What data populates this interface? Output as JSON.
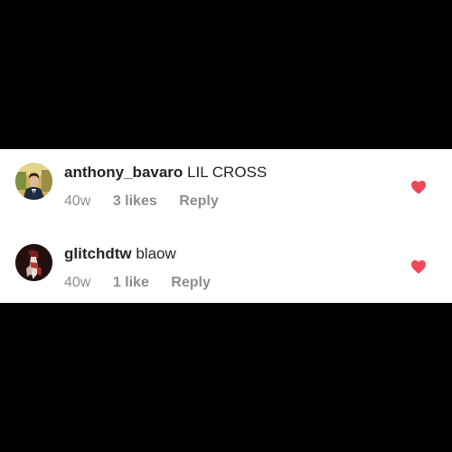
{
  "colors": {
    "background": "#000000",
    "panel": "#ffffff",
    "username": "#262626",
    "meta": "#8e8e8e",
    "heart": "#ed4956"
  },
  "comments": [
    {
      "username": "anthony_bavaro",
      "text": "LIL CROSS",
      "timestamp": "40w",
      "likes": "3 likes",
      "reply": "Reply",
      "liked": true,
      "like_icon": "heart-filled-icon"
    },
    {
      "username": "glitchdtw",
      "text": "blaow",
      "timestamp": "40w",
      "likes": "1 like",
      "reply": "Reply",
      "liked": true,
      "like_icon": "heart-filled-icon"
    }
  ]
}
